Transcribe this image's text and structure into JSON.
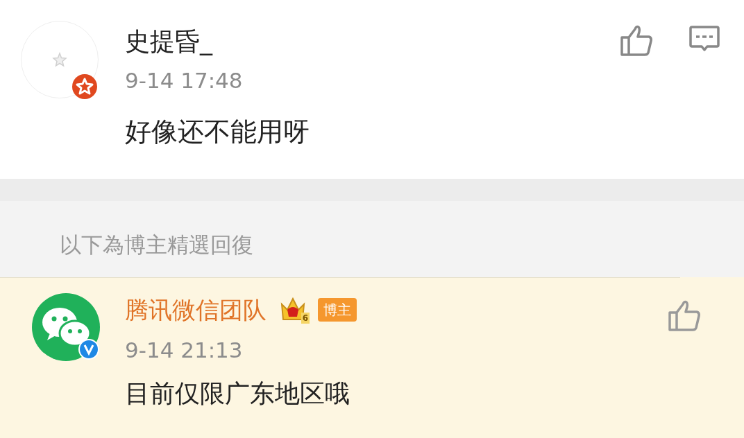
{
  "comment": {
    "author": "史提昏_",
    "time": "9-14 17:48",
    "text": "好像还不能用呀",
    "actions": [
      {
        "kind": "like"
      },
      {
        "kind": "reply"
      }
    ]
  },
  "section_header": "以下為博主精選回復",
  "reply": {
    "author": "腾讯微信团队",
    "crown_level": "6",
    "tag": "博主",
    "time": "9-14 21:13",
    "text": "目前仅限广东地区哦",
    "actions": [
      {
        "kind": "like"
      }
    ]
  }
}
